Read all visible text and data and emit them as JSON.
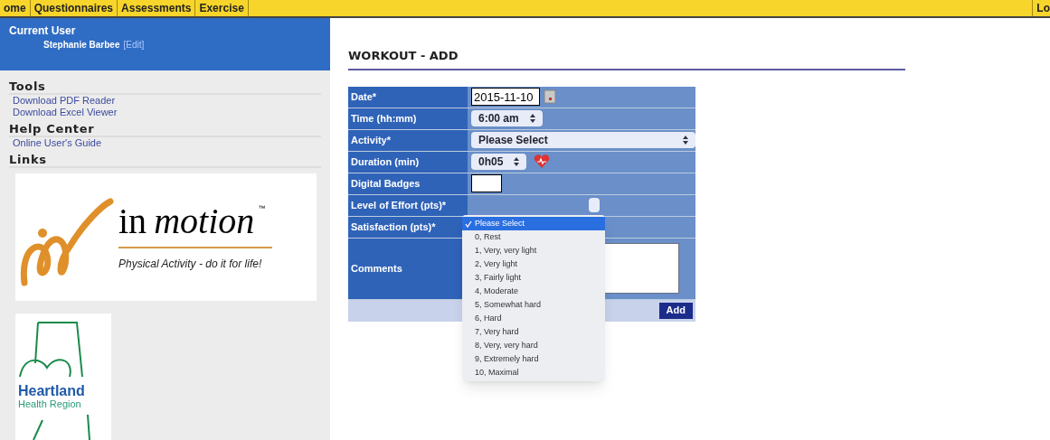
{
  "nav": {
    "items": [
      {
        "label": "ome"
      },
      {
        "label": "Questionnaires"
      },
      {
        "label": "Assessments"
      },
      {
        "label": "Exercise"
      }
    ],
    "right": "Lo"
  },
  "sidebar": {
    "user_heading": "Current User",
    "user_name": "Stephanie Barbee",
    "edit_link": "[Edit]",
    "sections": [
      {
        "title": "Tools",
        "links": [
          "Download PDF Reader",
          "Download Excel Viewer"
        ]
      },
      {
        "title": "Help Center",
        "links": [
          "Online User's Guide"
        ]
      },
      {
        "title": "Links"
      }
    ],
    "logos": [
      {
        "kind": "inmotion",
        "word1": "in",
        "word2": "motion",
        "tm": "™",
        "tagline": "Physical Activity - do it for life!"
      },
      {
        "kind": "heartland",
        "line1": "Heartland",
        "line2": "Health Region"
      }
    ]
  },
  "page_title": "WORKOUT - ADD",
  "form": {
    "rows": [
      {
        "label": "Date*",
        "kind": "date",
        "value": "2015-11-10"
      },
      {
        "label": "Time (hh:mm)",
        "kind": "select",
        "value": "6:00 am"
      },
      {
        "label": "Activity*",
        "kind": "wideselect",
        "value": "Please Select"
      },
      {
        "label": "Duration (min)",
        "kind": "duration",
        "value": "0h05"
      },
      {
        "label": "Digital Badges",
        "kind": "badge"
      },
      {
        "label": "Level of Effort (pts)*",
        "kind": "open"
      },
      {
        "label": "Satisfaction (pts)*",
        "kind": "hidden"
      },
      {
        "label": "Comments",
        "kind": "textarea"
      }
    ],
    "submit": "Add"
  },
  "dropdown": {
    "options": [
      {
        "label": "Please Select",
        "selected": true
      },
      {
        "label": "0, Rest",
        "selected": false
      },
      {
        "label": "1, Very, very light",
        "selected": false
      },
      {
        "label": "2, Very light",
        "selected": false
      },
      {
        "label": "3, Fairly light",
        "selected": false
      },
      {
        "label": "4, Moderate",
        "selected": false
      },
      {
        "label": "5, Somewhat hard",
        "selected": false
      },
      {
        "label": "6, Hard",
        "selected": false
      },
      {
        "label": "7, Very hard",
        "selected": false
      },
      {
        "label": "8, Very, very hard",
        "selected": false
      },
      {
        "label": "9, Extremely hard",
        "selected": false
      },
      {
        "label": "10, Maximal",
        "selected": false
      }
    ]
  }
}
